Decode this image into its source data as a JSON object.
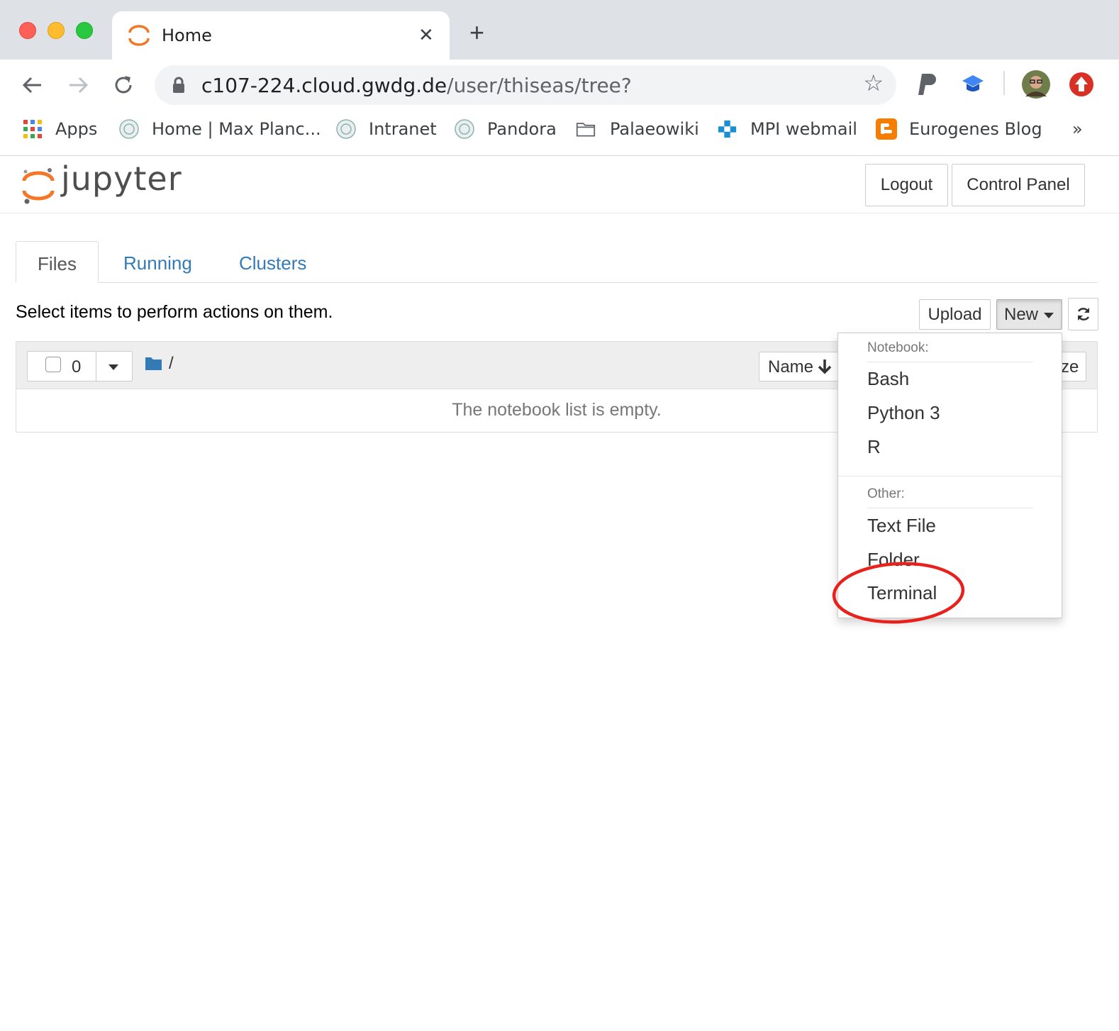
{
  "browser": {
    "tab_title": "Home",
    "url_host": "c107-224.cloud.gwdg.de",
    "url_path": "/user/thiseas/tree?",
    "bookmarks": [
      {
        "label": "Apps",
        "icon": "apps-grid-icon"
      },
      {
        "label": "Home | Max Planc...",
        "icon": "mpg-logo-icon"
      },
      {
        "label": "Intranet",
        "icon": "mpg-logo-icon"
      },
      {
        "label": "Pandora",
        "icon": "mpg-logo-icon"
      },
      {
        "label": "Palaeowiki",
        "icon": "folder-icon"
      },
      {
        "label": "MPI webmail",
        "icon": "webmail-icon"
      },
      {
        "label": "Eurogenes Blog",
        "icon": "blogger-icon"
      }
    ],
    "bookmarks_overflow": "»"
  },
  "header": {
    "logo_text": "jupyter",
    "logout_label": "Logout",
    "control_panel_label": "Control Panel"
  },
  "tabs": [
    {
      "label": "Files"
    },
    {
      "label": "Running"
    },
    {
      "label": "Clusters"
    }
  ],
  "toolbar": {
    "hint": "Select items to perform actions on them.",
    "upload_label": "Upload",
    "new_label": "New"
  },
  "list": {
    "selected_count": "0",
    "path": "/",
    "sort_label": "Name",
    "size_label_fragment": "ze",
    "empty_message": "The notebook list is empty."
  },
  "new_menu": {
    "notebook_header": "Notebook:",
    "notebook_items": [
      "Bash",
      "Python 3",
      "R"
    ],
    "other_header": "Other:",
    "other_items": [
      "Text File",
      "Folder",
      "Terminal"
    ]
  },
  "colors": {
    "accent_link": "#337ab7",
    "jupyter_orange": "#f37726",
    "annotation_red": "#e8211d"
  }
}
